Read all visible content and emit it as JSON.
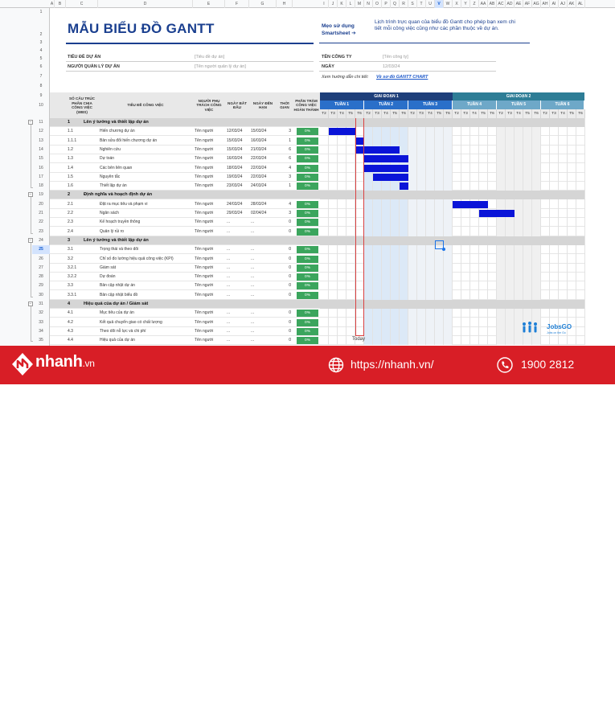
{
  "columns": {
    "letters": [
      "A",
      "B",
      "C",
      "D",
      "E",
      "F",
      "G",
      "H",
      "I",
      "J",
      "K",
      "L",
      "M",
      "N",
      "O",
      "P",
      "Q",
      "R",
      "S",
      "T",
      "U",
      "V",
      "W",
      "X",
      "Y",
      "Z",
      "AA",
      "AB",
      "AC",
      "AD",
      "AE",
      "AF",
      "AG",
      "AH",
      "AI",
      "AJ",
      "AK",
      "AL"
    ],
    "selected": "V"
  },
  "title": "MẪU BIỂU ĐỒ GANTT",
  "tip": {
    "label": "Mẹo sử dụng Smartsheet ➔",
    "text": "Lịch trình trực quan của biểu đồ Gantt cho phép bạn xem chi tiết mỗi công việc cũng như các phần thuộc về dự án."
  },
  "fields": {
    "project_title_label": "TIÊU ĐỀ DỰ ÁN",
    "project_title_value": "[Tiêu đề dự án]",
    "manager_label": "NGƯỜI QUẢN LÝ DỰ ÁN",
    "manager_value": "[Tên người quản lý dự án]",
    "company_label": "TÊN CÔNG TY",
    "company_value": "[Tên công ty]",
    "date_label": "NGÀY",
    "date_value": "12/03/24"
  },
  "guide": {
    "prefix": "Xem hướng dẫn chi tiết:",
    "link": "Về sơ đồ GANTT CHART"
  },
  "headers": {
    "wbs": "SỐ CẤU TRÚC PHÂN CHIA CÔNG VIỆC (WBS)",
    "task": "TIÊU ĐỀ CÔNG VIỆC",
    "owner": "NGƯỜI PHỤ TRÁCH CÔNG VIỆC",
    "start": "NGÀY BẮT ĐẦU",
    "due": "NGÀY ĐẾN HẠN",
    "duration": "THỜI GIAN",
    "pct": "PHẦN TRĂM CÔNG VIỆC HOÀN THÀNH"
  },
  "phases": [
    {
      "label": "GIAI ĐOẠN 1",
      "color": "#1e3f7a"
    },
    {
      "label": "GIAI ĐOẠN 2",
      "color": "#2e7d96"
    }
  ],
  "weeks": [
    {
      "label": "TUẦN 1",
      "color": "#2a6fc9"
    },
    {
      "label": "TUẦN 2",
      "color": "#2a6fc9"
    },
    {
      "label": "TUẦN 3",
      "color": "#2a6fc9"
    },
    {
      "label": "TUẦN 4",
      "color": "#6ea8c8"
    },
    {
      "label": "TUẦN 5",
      "color": "#6ea8c8"
    },
    {
      "label": "TUẦN 6",
      "color": "#6ea8c8"
    }
  ],
  "days": [
    "T2",
    "T3",
    "T4",
    "T5",
    "T6",
    "T2",
    "T3",
    "T4",
    "T5",
    "T6",
    "T2",
    "T3",
    "T4",
    "T5",
    "T6",
    "T2",
    "T3",
    "T4",
    "T5",
    "T6",
    "T2",
    "T3",
    "T4",
    "T5",
    "T6",
    "T2",
    "T3",
    "T4",
    "T5",
    "T6"
  ],
  "rows": [
    {
      "n": "11",
      "type": "section",
      "wbs": "1",
      "task": "Lên ý tưởng và thiết lập dự án"
    },
    {
      "n": "12",
      "wbs": "1.1",
      "task": "Hiến chương dự án",
      "owner": "Tên người",
      "start": "12/03/24",
      "due": "15/03/24",
      "dur": "3",
      "pct": "0%",
      "bar": [
        1,
        4
      ]
    },
    {
      "n": "13",
      "wbs": "1.1.1",
      "task": "Bản sửa đổi hiến chương dự án",
      "owner": "Tên người",
      "start": "15/03/24",
      "due": "16/03/24",
      "dur": "1",
      "pct": "0%",
      "bar": [
        4,
        5
      ]
    },
    {
      "n": "14",
      "wbs": "1.2",
      "task": "Nghiên cứu",
      "owner": "Tên người",
      "start": "15/03/24",
      "due": "21/03/24",
      "dur": "6",
      "pct": "0%",
      "bar": [
        4,
        9
      ]
    },
    {
      "n": "15",
      "wbs": "1.3",
      "task": "Dự toán",
      "owner": "Tên người",
      "start": "16/03/24",
      "due": "22/03/24",
      "dur": "6",
      "pct": "0%",
      "bar": [
        5,
        10
      ]
    },
    {
      "n": "16",
      "wbs": "1.4",
      "task": "Các bên liên quan",
      "owner": "Tên người",
      "start": "18/03/24",
      "due": "22/03/24",
      "dur": "4",
      "pct": "0%",
      "bar": [
        5,
        10
      ]
    },
    {
      "n": "17",
      "wbs": "1.5",
      "task": "Nguyên tắc",
      "owner": "Tên người",
      "start": "19/03/24",
      "due": "22/03/24",
      "dur": "3",
      "pct": "0%",
      "bar": [
        6,
        10
      ]
    },
    {
      "n": "18",
      "wbs": "1.6",
      "task": "Thiết lập dự án",
      "owner": "Tên người",
      "start": "23/03/24",
      "due": "24/03/24",
      "dur": "1",
      "pct": "0%",
      "bar": [
        9,
        10
      ]
    },
    {
      "n": "19",
      "type": "section",
      "wbs": "2",
      "task": "Định nghĩa và hoạch định dự án"
    },
    {
      "n": "20",
      "wbs": "2.1",
      "task": "Đặt ra mục tiêu và phạm vi",
      "owner": "Tên người",
      "start": "24/03/24",
      "due": "28/03/24",
      "dur": "4",
      "pct": "0%",
      "bar": [
        15,
        19
      ]
    },
    {
      "n": "21",
      "wbs": "2.2",
      "task": "Ngân sách",
      "owner": "Tên người",
      "start": "29/03/24",
      "due": "02/04/24",
      "dur": "3",
      "pct": "0%",
      "bar": [
        18,
        22
      ]
    },
    {
      "n": "22",
      "wbs": "2.3",
      "task": "Kế hoạch truyền thông",
      "owner": "Tên người",
      "start": "...",
      "due": "...",
      "dur": "0",
      "pct": "0%"
    },
    {
      "n": "23",
      "wbs": "2.4",
      "task": "Quản lý rủi ro",
      "owner": "Tên người",
      "start": "...",
      "due": "...",
      "dur": "0",
      "pct": "0%"
    },
    {
      "n": "24",
      "type": "section",
      "wbs": "3",
      "task": "Lên ý tưởng và thiết lập dự án"
    },
    {
      "n": "25",
      "wbs": "3.1",
      "task": "Trọng thái và theo dõi",
      "owner": "Tên người",
      "start": "...",
      "due": "...",
      "dur": "0",
      "pct": "0%"
    },
    {
      "n": "26",
      "wbs": "3.2",
      "task": "Chỉ số đo lường hiệu quả công việc (KPI)",
      "owner": "Tên người",
      "start": "...",
      "due": "...",
      "dur": "0",
      "pct": "0%"
    },
    {
      "n": "27",
      "wbs": "3.2.1",
      "task": "Giám sát",
      "owner": "Tên người",
      "start": "...",
      "due": "...",
      "dur": "0",
      "pct": "0%"
    },
    {
      "n": "28",
      "wbs": "3.2.2",
      "task": "Dự đoán",
      "owner": "Tên người",
      "start": "...",
      "due": "...",
      "dur": "0",
      "pct": "0%"
    },
    {
      "n": "29",
      "wbs": "3.3",
      "task": "Bản cập nhật dự án",
      "owner": "Tên người",
      "start": "...",
      "due": "...",
      "dur": "0",
      "pct": "0%"
    },
    {
      "n": "30",
      "wbs": "3.3.1",
      "task": "Bản cập nhật biểu đồ",
      "owner": "Tên người",
      "start": "...",
      "due": "...",
      "dur": "0",
      "pct": "0%"
    },
    {
      "n": "31",
      "type": "section",
      "wbs": "4",
      "task": "Hiệu quả của dự án / Giám sát"
    },
    {
      "n": "32",
      "wbs": "4.1",
      "task": "Mục tiêu của dự án",
      "owner": "Tên người",
      "start": "...",
      "due": "...",
      "dur": "0",
      "pct": "0%"
    },
    {
      "n": "33",
      "wbs": "4.2",
      "task": "Kết quả chuyển giao có chất lượng",
      "owner": "Tên người",
      "start": "...",
      "due": "...",
      "dur": "0",
      "pct": "0%"
    },
    {
      "n": "34",
      "wbs": "4.3",
      "task": "Theo dõi nỗ lực và chi phí",
      "owner": "Tên người",
      "start": "...",
      "due": "...",
      "dur": "0",
      "pct": "0%"
    },
    {
      "n": "35",
      "wbs": "4.4",
      "task": "Hiệu quả của dự án",
      "owner": "Tên người",
      "start": "...",
      "due": "...",
      "dur": "0",
      "pct": "0%"
    },
    {
      "n": "36",
      "type": "blank"
    }
  ],
  "top_rows": [
    "1",
    "",
    "2",
    "3",
    "4",
    "5",
    "6",
    "7",
    "8",
    "9",
    "10"
  ],
  "selected_row": "25",
  "today_label": "Today",
  "logo": {
    "name": "JobsGO",
    "tagline": "Jobs on the Go"
  },
  "footer": {
    "brand": "nhanh",
    "brand_suffix": ".vn",
    "website": "https://nhanh.vn/",
    "phone": "1900 2812",
    "bg_color": "#d81e26"
  }
}
